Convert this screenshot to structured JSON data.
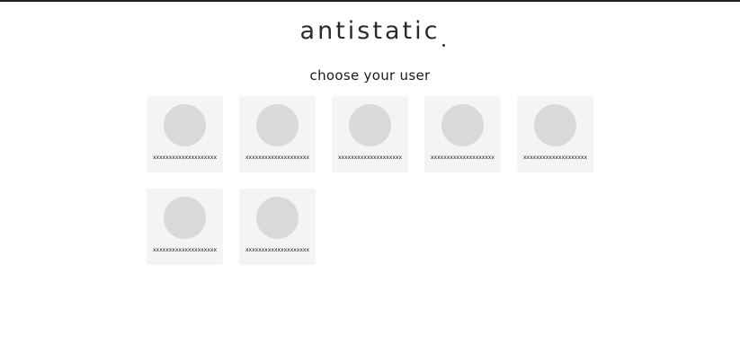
{
  "header": {
    "logo_text": "antistatic"
  },
  "main": {
    "title": "choose your user",
    "users": [
      {
        "name": "xxxxxxxxxxxxxxxxxxxx"
      },
      {
        "name": "xxxxxxxxxxxxxxxxxxxx"
      },
      {
        "name": "xxxxxxxxxxxxxxxxxxxx"
      },
      {
        "name": "xxxxxxxxxxxxxxxxxxxx"
      },
      {
        "name": "xxxxxxxxxxxxxxxxxxxx"
      },
      {
        "name": "xxxxxxxxxxxxxxxxxxxx"
      },
      {
        "name": "xxxxxxxxxxxxxxxxxxxx"
      }
    ]
  },
  "colors": {
    "background": "#ffffff",
    "card": "#f4f4f4",
    "avatar_placeholder": "#d9d9d9",
    "text": "#1a1a1a"
  }
}
